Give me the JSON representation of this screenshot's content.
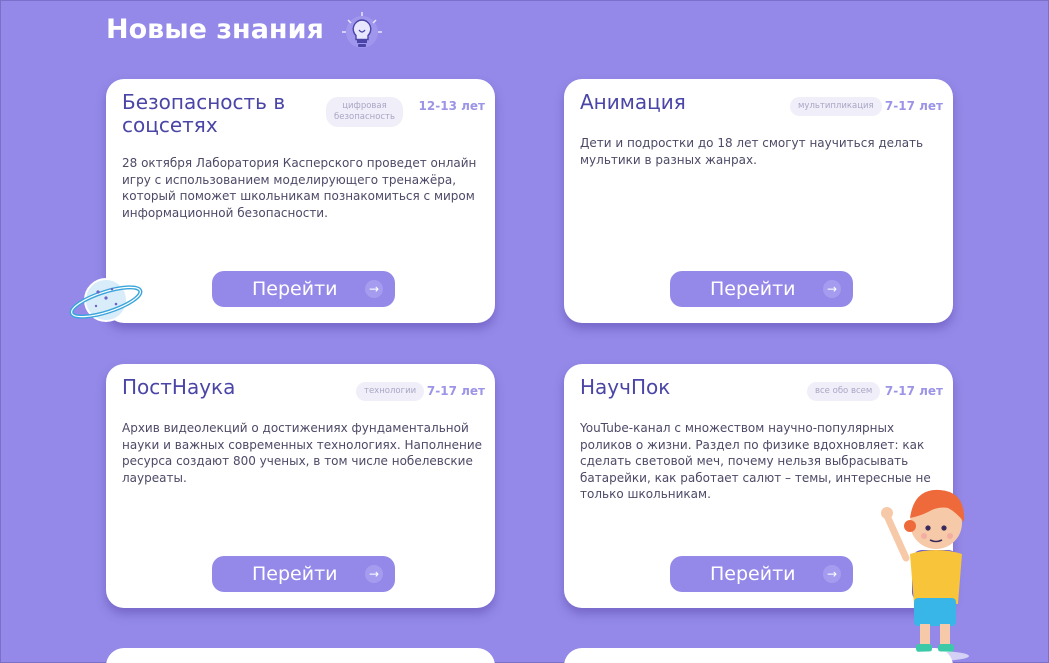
{
  "section": {
    "title": "Новые знания"
  },
  "colors": {
    "background": "#9489e8",
    "accent": "#4a45a6",
    "button": "#9489e8"
  },
  "icons": {
    "header": "lightbulb-icon",
    "decor_left": "planet-illustration",
    "decor_right": "kid-waving-illustration",
    "button": "arrow-right-icon"
  },
  "cards": [
    {
      "title": "Безопасность в соцсетях",
      "tag_line1": "цифровая",
      "tag_line2": "безопасность",
      "age": "12-13 лет",
      "description": "28 октября Лаборатория Касперского проведет онлайн игру с использованием моделирующего тренажёра, который поможет школьникам познакомиться с миром информационной безопасности.",
      "button": "Перейти"
    },
    {
      "title": "Анимация",
      "tag": "мультипликация",
      "age": "7-17 лет",
      "description": "Дети и подростки до 18 лет смогут научиться делать мультики в разных жанрах.",
      "button": "Перейти"
    },
    {
      "title": "ПостНаука",
      "tag": "технологии",
      "age": "7-17 лет",
      "description": "Архив видеолекций о достижениях фундаментальной науки и важных современных технологиях. Наполнение ресурса создают 800 ученых, в том числе нобелевские лауреаты.",
      "button": "Перейти"
    },
    {
      "title": "НаучПок",
      "tag": "все обо всем",
      "age": "7-17 лет",
      "description": "YouTube-канал с множеством научно-популярных роликов о жизни. Раздел по физике вдохновляет: как сделать световой меч, почему нельзя выбрасывать батарейки, как работает салют – темы, интересные не только школьникам.",
      "button": "Перейти"
    }
  ]
}
